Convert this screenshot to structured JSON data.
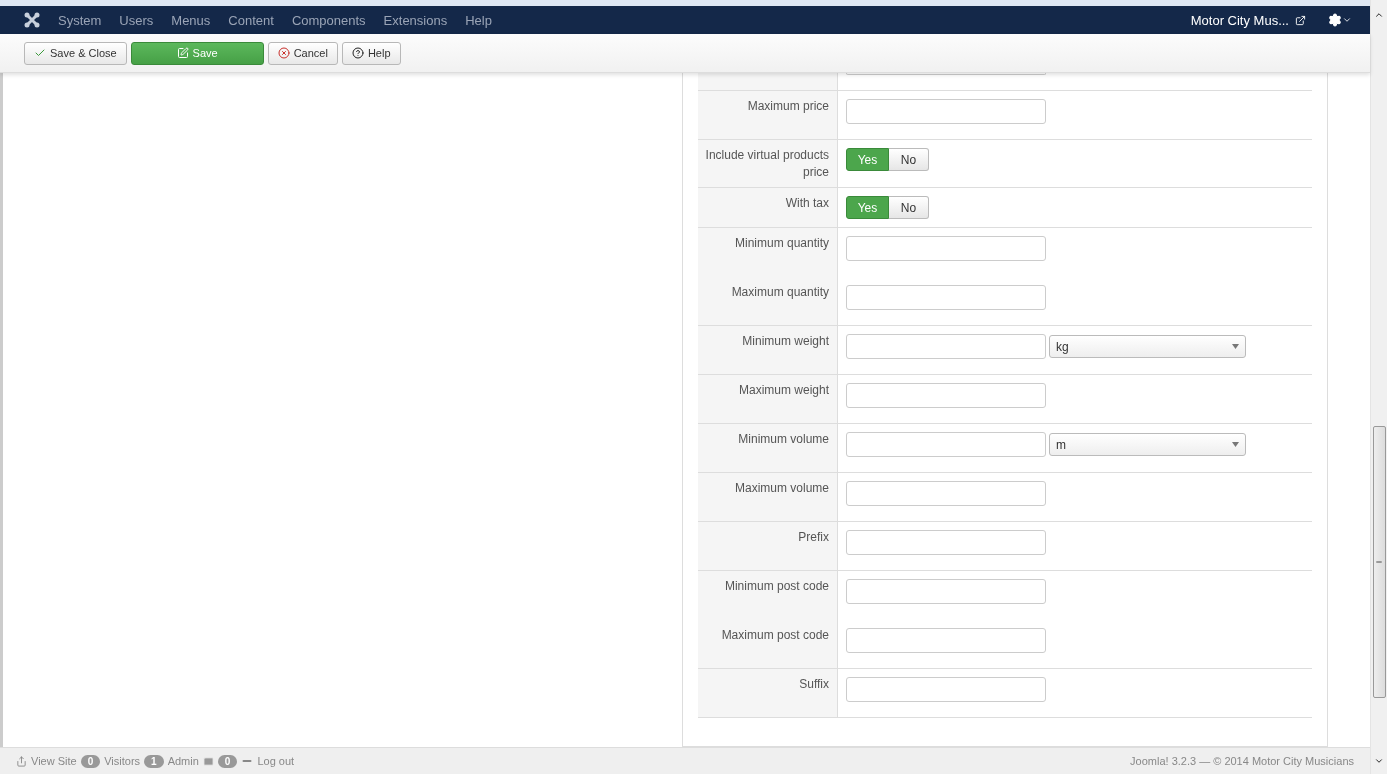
{
  "navbar": {
    "menu": [
      "System",
      "Users",
      "Menus",
      "Content",
      "Components",
      "Extensions",
      "Help"
    ],
    "site_name": "Motor City Mus..."
  },
  "toolbar": [
    {
      "label": "Save & Close",
      "kind": "save-close"
    },
    {
      "label": "Save",
      "kind": "save"
    },
    {
      "label": "Cancel",
      "kind": "cancel"
    },
    {
      "label": "Help",
      "kind": "help"
    }
  ],
  "form": {
    "groups": [
      {
        "fields": [
          {
            "kind": "partial"
          }
        ]
      },
      {
        "fields": [
          {
            "label": "Maximum price",
            "kind": "text"
          }
        ]
      },
      {
        "fields": [
          {
            "label": "Include virtual products price",
            "kind": "toggle",
            "options": [
              {
                "label": "Yes",
                "selected": true
              },
              {
                "label": "No",
                "selected": false
              }
            ]
          }
        ]
      },
      {
        "fields": [
          {
            "label": "With tax",
            "kind": "toggle",
            "options": [
              {
                "label": "Yes",
                "selected": true
              },
              {
                "label": "No",
                "selected": false
              }
            ]
          }
        ]
      },
      {
        "fields": [
          {
            "label": "Minimum quantity",
            "kind": "text"
          },
          {
            "label": "Maximum quantity",
            "kind": "text"
          }
        ]
      },
      {
        "fields": [
          {
            "label": "Minimum weight",
            "kind": "unit",
            "unit": "kg"
          }
        ]
      },
      {
        "fields": [
          {
            "label": "Maximum weight",
            "kind": "text"
          }
        ]
      },
      {
        "fields": [
          {
            "label": "Minimum volume",
            "kind": "unit",
            "unit": "m"
          }
        ]
      },
      {
        "fields": [
          {
            "label": "Maximum volume",
            "kind": "text"
          }
        ]
      },
      {
        "fields": [
          {
            "label": "Prefix",
            "kind": "text"
          }
        ]
      },
      {
        "fields": [
          {
            "label": "Minimum post code",
            "kind": "text"
          },
          {
            "label": "Maximum post code",
            "kind": "text"
          }
        ]
      },
      {
        "fields": [
          {
            "label": "Suffix",
            "kind": "text"
          }
        ]
      }
    ]
  },
  "status_bar": {
    "view_site": "View Site",
    "visitors_count": "0",
    "visitors": "Visitors",
    "admin_count": "1",
    "admin": "Admin",
    "messages_count": "0",
    "logout": "Log out",
    "footer": "Joomla! 3.2.3 — © 2014 Motor City Musicians"
  }
}
